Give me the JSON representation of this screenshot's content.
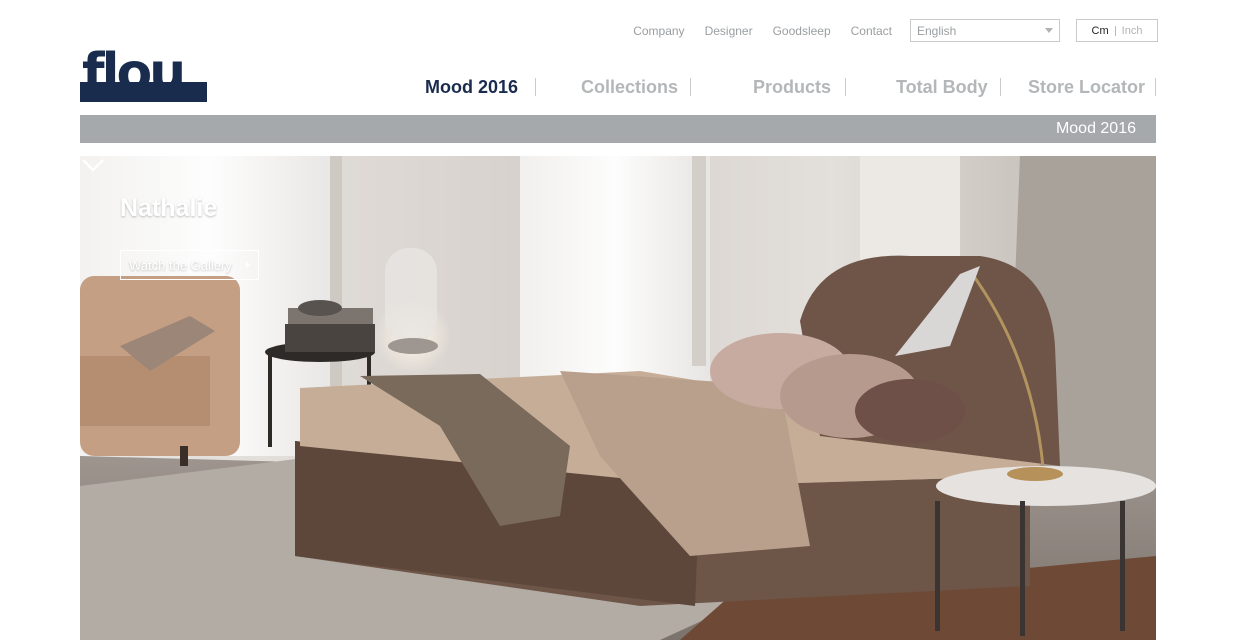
{
  "utility_nav": {
    "links": [
      "Company",
      "Designer",
      "Goodsleep",
      "Contact"
    ],
    "language": {
      "selected": "English"
    },
    "units": {
      "active": "Cm",
      "inactive": "Inch"
    }
  },
  "logo": {
    "text": "flou",
    "color": "#1a2c4e"
  },
  "main_nav": {
    "items": [
      "Mood 2016",
      "Collections",
      "Products",
      "Total Body",
      "Store Locator"
    ],
    "active_index": 0
  },
  "breadcrumb": {
    "current": "Mood 2016"
  },
  "hero": {
    "title": "Nathalie",
    "button_label": "Watch the Gallery",
    "scroll_icon": "chevron-down-icon"
  },
  "colors": {
    "brand": "#1a2c4e",
    "nav_inactive": "#b4b7b9",
    "crumb_bar": "#a5a9ac"
  }
}
